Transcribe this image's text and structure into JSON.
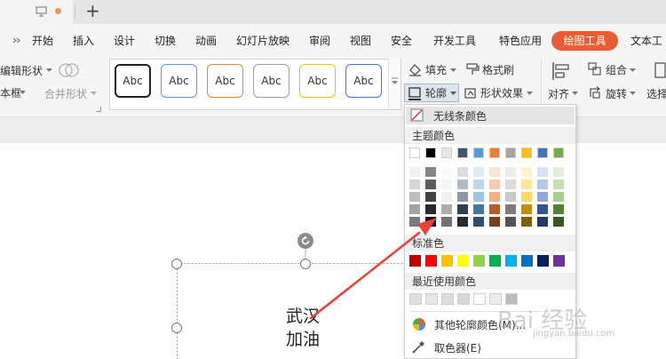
{
  "tabs": {
    "new_tab_symbol": "+"
  },
  "menu": {
    "items": [
      "开始",
      "插入",
      "设计",
      "切换",
      "动画",
      "幻灯片放映",
      "审阅",
      "视图",
      "安全",
      "开发工具",
      "特色应用"
    ],
    "active": "绘图工具",
    "trailing": "文本工"
  },
  "ribbon": {
    "edit_shape": "编辑形状",
    "textbox": "本框",
    "merge_shapes": "合并形状",
    "style_label": "Abc",
    "fill": "填充",
    "format_painter": "格式刷",
    "outline": "轮廓",
    "shape_effect": "形状效果",
    "align": "对齐",
    "group": "组合",
    "rotate": "旋转",
    "select": "选择"
  },
  "style_colors": [
    "#222222",
    "#5b9bd5",
    "#e08a38",
    "#a0a0a0",
    "#f1c40f",
    "#4472c4"
  ],
  "outline_menu": {
    "no_line": "无线条颜色",
    "theme_colors": "主题颜色",
    "standard_colors": "标准色",
    "recent_colors": "最近使用颜色",
    "more_colors": "其他轮廓颜色(M)...",
    "eyedropper": "取色器(E)",
    "theme_base": [
      "#ffffff",
      "#000000",
      "#e7e6e6",
      "#44546a",
      "#5b9bd5",
      "#ed7d31",
      "#a5a5a5",
      "#ffc000",
      "#4472c4",
      "#70ad47"
    ],
    "standard": [
      "#c00000",
      "#ff0000",
      "#ffc000",
      "#ffff00",
      "#92d050",
      "#00b050",
      "#00b0f0",
      "#0070c0",
      "#002060",
      "#7030a0"
    ],
    "recent": [
      "#e0e0e0",
      "#e6e6e6",
      "#dedede",
      "#d8d8d8",
      "#ffffff",
      "#ececec",
      "#bdbdbd"
    ]
  },
  "slide": {
    "text_line1": "武汉",
    "text_line2": "加油"
  },
  "watermark": {
    "text": "Bai 经验",
    "url": "jingyan.baidu.com"
  }
}
